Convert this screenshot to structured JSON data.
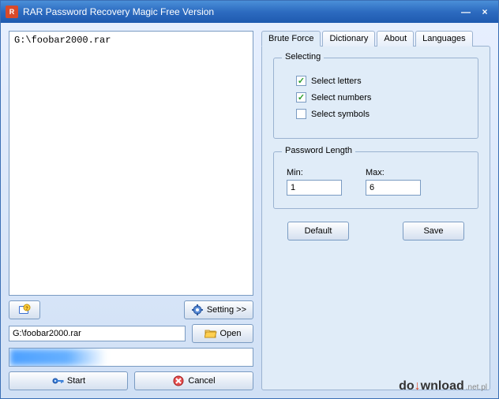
{
  "window": {
    "title": "RAR Password Recovery Magic Free Version",
    "minimize": "—",
    "close": "×"
  },
  "left": {
    "file_list_entry": "G:\\foobar2000.rar",
    "help_label": "",
    "setting_label": "Setting >>",
    "path_value": "G:\\foobar2000.rar",
    "open_label": "Open",
    "start_label": "Start",
    "cancel_label": "Cancel"
  },
  "tabs": {
    "brute": "Brute Force",
    "dict": "Dictionary",
    "about": "About",
    "lang": "Languages"
  },
  "selecting": {
    "group_title": "Selecting",
    "letters": {
      "label": "Select letters",
      "checked": true
    },
    "numbers": {
      "label": "Select numbers",
      "checked": true
    },
    "symbols": {
      "label": "Select symbols",
      "checked": false
    }
  },
  "length": {
    "group_title": "Password Length",
    "min_label": "Min:",
    "min_value": "1",
    "max_label": "Max:",
    "max_value": "6"
  },
  "panel_buttons": {
    "default": "Default",
    "save": "Save"
  },
  "watermark": {
    "text1": "do",
    "text2": "wnload",
    "sub": ".net.pl"
  }
}
